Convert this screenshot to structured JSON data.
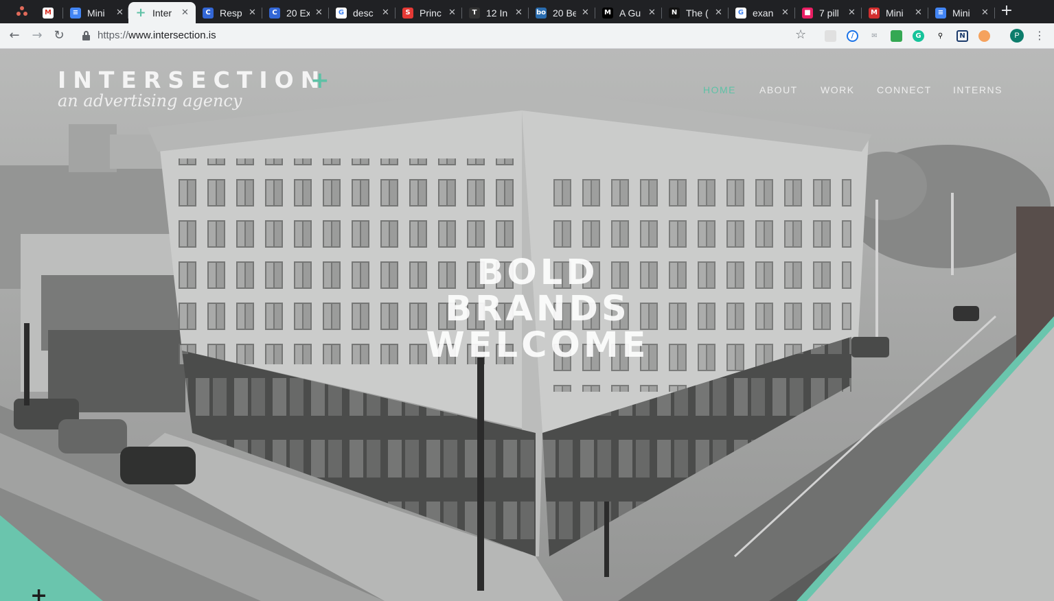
{
  "browser": {
    "tabs": [
      {
        "label": "Mini",
        "icon": "google-docs-icon",
        "color": "#4285f4"
      },
      {
        "label": "Inter",
        "icon": "intersection-plus-icon",
        "color": "#5ec1a6",
        "active": true
      },
      {
        "label": "Resp",
        "icon": "c-circle-icon",
        "color": "#3367d6"
      },
      {
        "label": "20 Ex",
        "icon": "c-circle-icon",
        "color": "#3367d6"
      },
      {
        "label": "desc",
        "icon": "google-g-icon",
        "color": "#ffffff"
      },
      {
        "label": "Princ",
        "icon": "s-letter-icon",
        "color": "#e53935"
      },
      {
        "label": "12 In",
        "icon": "t-letter-icon",
        "color": "#333333"
      },
      {
        "label": "20 Be",
        "icon": "bo-letter-icon",
        "color": "#2a6db0"
      },
      {
        "label": "A Gu",
        "icon": "medium-m-icon",
        "color": "#000000"
      },
      {
        "label": "The (",
        "icon": "nn-letter-icon",
        "color": "#111111"
      },
      {
        "label": "exan",
        "icon": "google-g-icon",
        "color": "#ffffff"
      },
      {
        "label": "7 pill",
        "icon": "trend-badge-icon",
        "color": "#e91e63"
      },
      {
        "label": "Mini",
        "icon": "m-letter-icon",
        "color": "#d32f2f"
      },
      {
        "label": "Mini",
        "icon": "google-docs-icon",
        "color": "#4285f4"
      }
    ],
    "new_tab_label": "+",
    "url_protocol": "https://",
    "url_host": "www.intersection.is",
    "profile_initial": "P"
  },
  "site": {
    "logo_text": "INTERSECTION",
    "logo_plus": "+",
    "tagline": "an advertising agency",
    "nav": [
      "HOME",
      "ABOUT",
      "WORK",
      "CONNECT",
      "INTERNS"
    ],
    "active_nav": "HOME",
    "headline": [
      "BOLD",
      "BRANDS",
      "WELCOME"
    ],
    "corner_plus": "+",
    "accent_color": "#5ec1a6"
  }
}
